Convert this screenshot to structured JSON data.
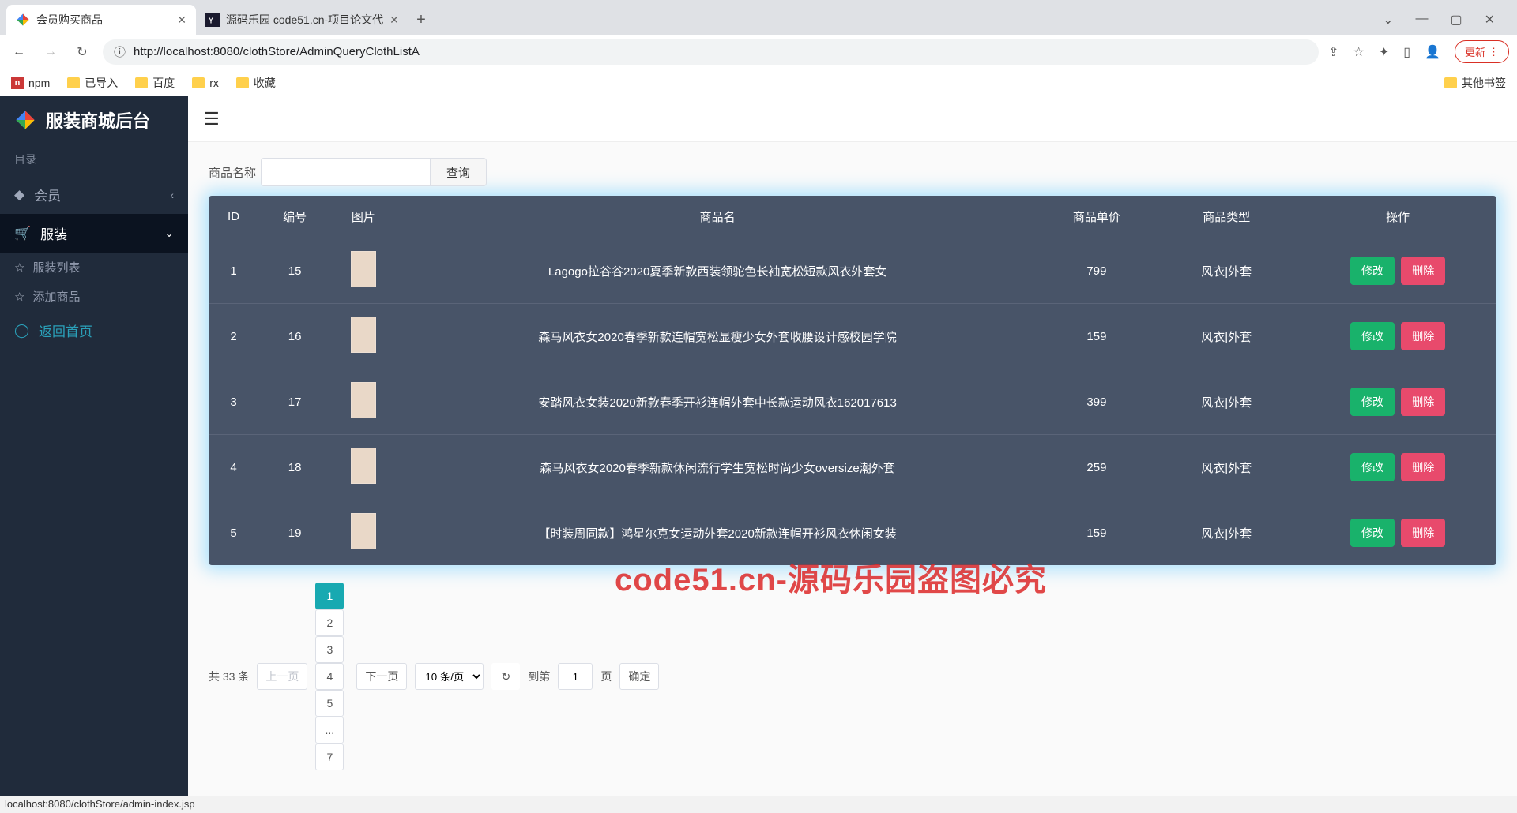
{
  "browser": {
    "tabs": [
      {
        "title": "会员购买商品",
        "active": true
      },
      {
        "title": "源码乐园 code51.cn-项目论文代",
        "active": false
      }
    ],
    "window_controls": {
      "min": "—",
      "max": "▢",
      "close": "✕"
    },
    "nav": {
      "back": "←",
      "forward": "→",
      "reload": "↻",
      "info": "ⓘ"
    },
    "url": "http://localhost:8080/clothStore/AdminQueryClothListA",
    "addr_right": {
      "share": "⇪",
      "star": "☆",
      "ext": "✦",
      "panel": "▯",
      "avatar": "👤"
    },
    "update": "更新",
    "bookmarks": [
      {
        "label": "npm",
        "icon": "n"
      },
      {
        "label": "已导入",
        "icon": "folder"
      },
      {
        "label": "百度",
        "icon": "folder"
      },
      {
        "label": "rx",
        "icon": "folder"
      },
      {
        "label": "收藏",
        "icon": "folder"
      }
    ],
    "other_bookmarks": "其他书签",
    "status": "localhost:8080/clothStore/admin-index.jsp"
  },
  "sidebar": {
    "brand": "服装商城后台",
    "section": "目录",
    "items": [
      {
        "icon": "◆",
        "label": "会员",
        "chev": "‹"
      },
      {
        "icon": "🛒",
        "label": "服装",
        "chev": "⌄",
        "active": true
      }
    ],
    "subitems": [
      {
        "label": "服装列表"
      },
      {
        "label": "添加商品"
      }
    ],
    "home": {
      "icon": "◯",
      "label": "返回首页"
    }
  },
  "search": {
    "label": "商品名称",
    "btn": "查询"
  },
  "table": {
    "headers": {
      "id": "ID",
      "no": "编号",
      "img": "图片",
      "name": "商品名",
      "price": "商品单价",
      "type": "商品类型",
      "ops": "操作"
    },
    "edit": "修改",
    "del": "删除",
    "rows": [
      {
        "id": "1",
        "no": "15",
        "name": "Lagogo拉谷谷2020夏季新款西装领驼色长袖宽松短款风衣外套女",
        "price": "799",
        "type": "风衣|外套"
      },
      {
        "id": "2",
        "no": "16",
        "name": "森马风衣女2020春季新款连帽宽松显瘦少女外套收腰设计感校园学院",
        "price": "159",
        "type": "风衣|外套"
      },
      {
        "id": "3",
        "no": "17",
        "name": "安踏风衣女装2020新款春季开衫连帽外套中长款运动风衣162017613",
        "price": "399",
        "type": "风衣|外套"
      },
      {
        "id": "4",
        "no": "18",
        "name": "森马风衣女2020春季新款休闲流行学生宽松时尚少女oversize潮外套",
        "price": "259",
        "type": "风衣|外套"
      },
      {
        "id": "5",
        "no": "19",
        "name": "【时装周同款】鸿星尔克女运动外套2020新款连帽开衫风衣休闲女装",
        "price": "159",
        "type": "风衣|外套"
      }
    ]
  },
  "pager": {
    "total_prefix": "共",
    "total": "33",
    "total_suffix": "条",
    "prev": "上一页",
    "pages": [
      "1",
      "2",
      "3",
      "4",
      "5",
      "...",
      "7"
    ],
    "next": "下一页",
    "per_page": "10 条/页",
    "refresh": "↻",
    "goto_prefix": "到第",
    "goto_value": "1",
    "goto_suffix": "页",
    "confirm": "确定"
  },
  "watermark": "code51.cn-源码乐园盗图必究"
}
